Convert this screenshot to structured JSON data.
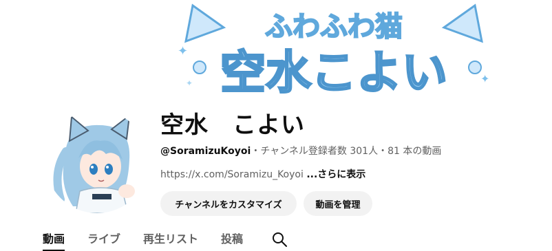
{
  "banner": {
    "line1": "ふわふわ猫",
    "line2": "空水こよい",
    "colors": {
      "fill": "#a9d6f2",
      "stroke": "#5fa8dc",
      "outline": "#ffffff"
    }
  },
  "channel": {
    "name": "空水　こよい",
    "handle": "@SoramizuKoyoi",
    "stats": "・チャンネル登録者数 301人・81 本の動画",
    "link": "https://x.com/Soramizu_Koyoi",
    "more_label": "...さらに表示"
  },
  "buttons": {
    "customize": "チャンネルをカスタマイズ",
    "manage": "動画を管理"
  },
  "tabs": [
    {
      "label": "動画",
      "active": true
    },
    {
      "label": "ライブ",
      "active": false
    },
    {
      "label": "再生リスト",
      "active": false
    },
    {
      "label": "投稿",
      "active": false
    }
  ],
  "icons": {
    "search": "search-icon"
  }
}
